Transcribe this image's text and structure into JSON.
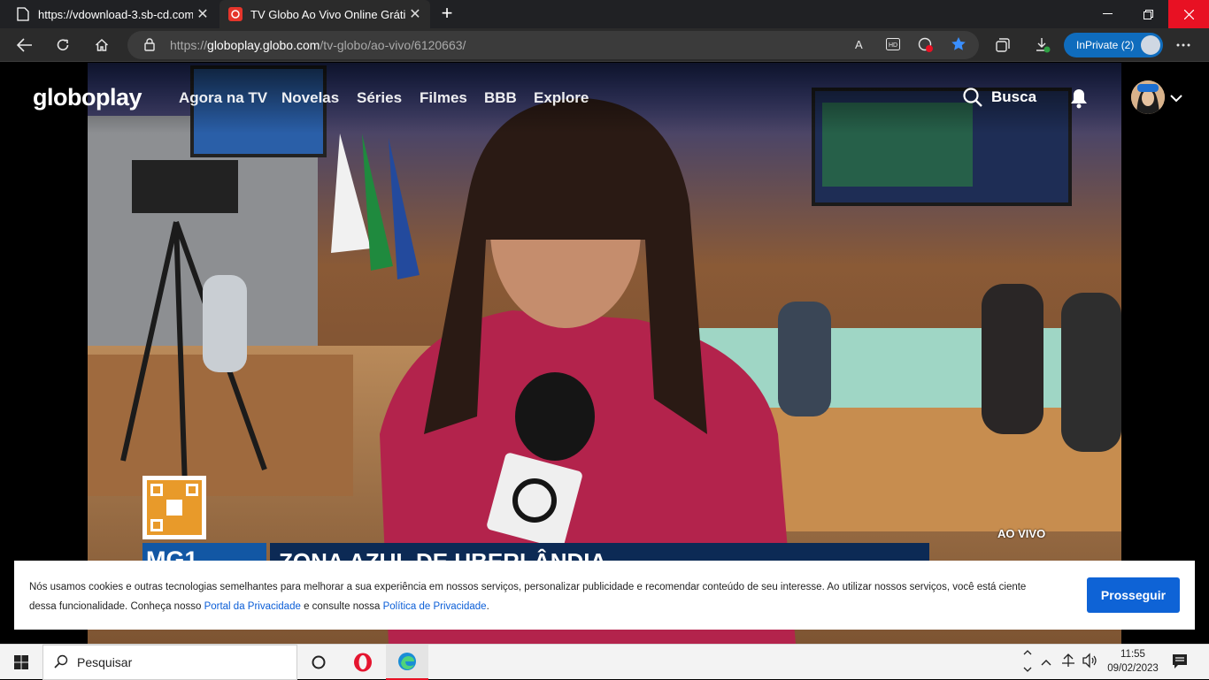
{
  "browser": {
    "tabs": [
      {
        "title": "https://vdownload-3.sb-cd.com/",
        "active": false
      },
      {
        "title": "TV Globo Ao Vivo Online Grátis |",
        "active": true
      }
    ],
    "url_prefix": "https://",
    "url_domain": "globoplay.globo.com",
    "url_path": "/tv-globo/ao-vivo/6120663/",
    "inprivate_label": "InPrivate (2)"
  },
  "site": {
    "logo": "globoplay",
    "nav": [
      "Agora na TV",
      "Novelas",
      "Séries",
      "Filmes",
      "BBB",
      "Explore"
    ],
    "search_label": "Busca"
  },
  "video": {
    "live_badge": "AO VIVO",
    "headline": "ZONA AZUL DE UBERLÂNDIA",
    "program": "MG1"
  },
  "cookie": {
    "text_1": "Nós usamos cookies e outras tecnologias semelhantes para melhorar a sua experiência em nossos serviços, personalizar publicidade e recomendar conteúdo de seu interesse. Ao utilizar nossos serviços, você está ciente dessa funcionalidade. Conheça nosso ",
    "link_1": "Portal da Privacidade",
    "text_2": " e consulte nossa ",
    "link_2": "Política de Privacidade",
    "text_3": ".",
    "button": "Prosseguir"
  },
  "taskbar": {
    "search_placeholder": "Pesquisar",
    "time": "11:55",
    "date": "09/02/2023"
  },
  "colors": {
    "accent_blue": "#0e63d6",
    "close_red": "#e81123",
    "tv_blue": "#0c2a55"
  }
}
